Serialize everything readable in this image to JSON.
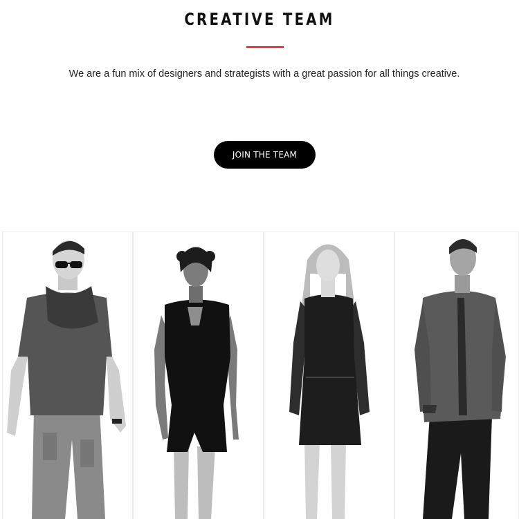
{
  "section": {
    "title": "CREATIVE TEAM",
    "subtitle": "We are a fun mix of designers and strategists with a great passion for all things creative.",
    "join_button_label": "JOIN THE TEAM"
  },
  "colors": {
    "accent": "#d7141a",
    "button_bg": "#000000",
    "button_text": "#ffffff"
  },
  "team": {
    "members": [
      {
        "photo": "man-sunglasses-scarf-photo"
      },
      {
        "photo": "woman-black-cutout-dress-photo"
      },
      {
        "photo": "woman-lace-dress-photo"
      },
      {
        "photo": "man-blazer-photo"
      }
    ]
  }
}
